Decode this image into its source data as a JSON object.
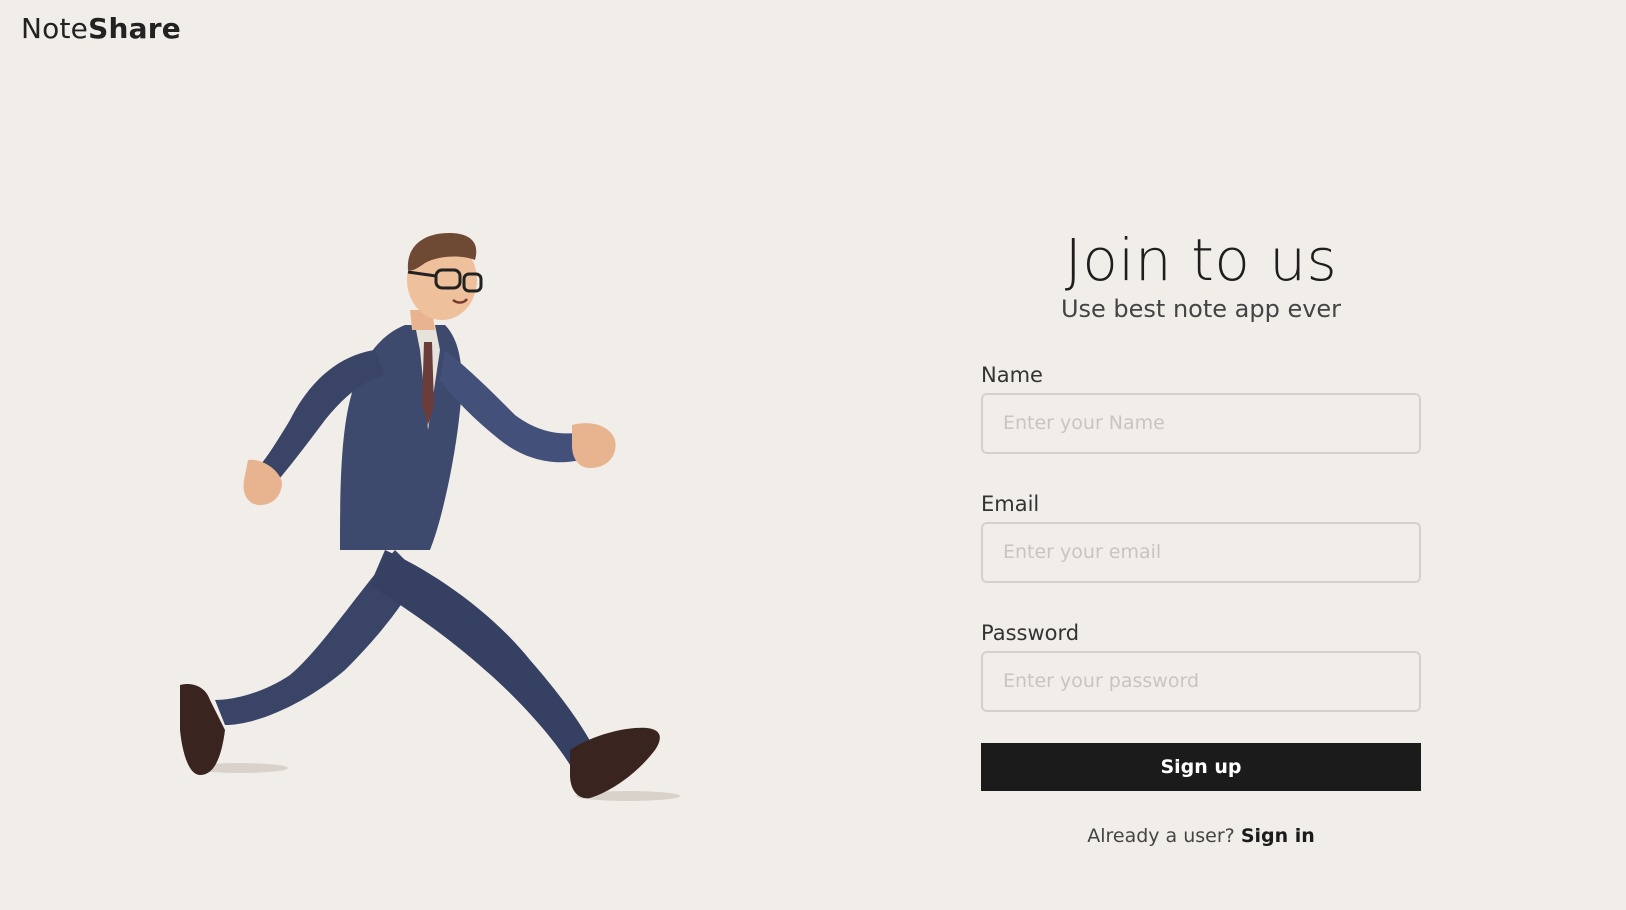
{
  "brand": {
    "name_light": "Note",
    "name_bold": "Share"
  },
  "illustration": {
    "icon": "running-businessman-illustration"
  },
  "signup": {
    "title": "Join to us",
    "subtitle": "Use best note app ever",
    "fields": [
      {
        "label": "Name",
        "placeholder": "Enter your Name",
        "value": ""
      },
      {
        "label": "Email",
        "placeholder": "Enter your email",
        "value": ""
      },
      {
        "label": "Password",
        "placeholder": "Enter your password",
        "value": ""
      }
    ],
    "submit_label": "Sign up",
    "signin_prompt": "Already a user?",
    "signin_link": "Sign in"
  },
  "colors": {
    "background": "#f1eeea",
    "button": "#1b1b1b",
    "suit": "#3a4466"
  }
}
